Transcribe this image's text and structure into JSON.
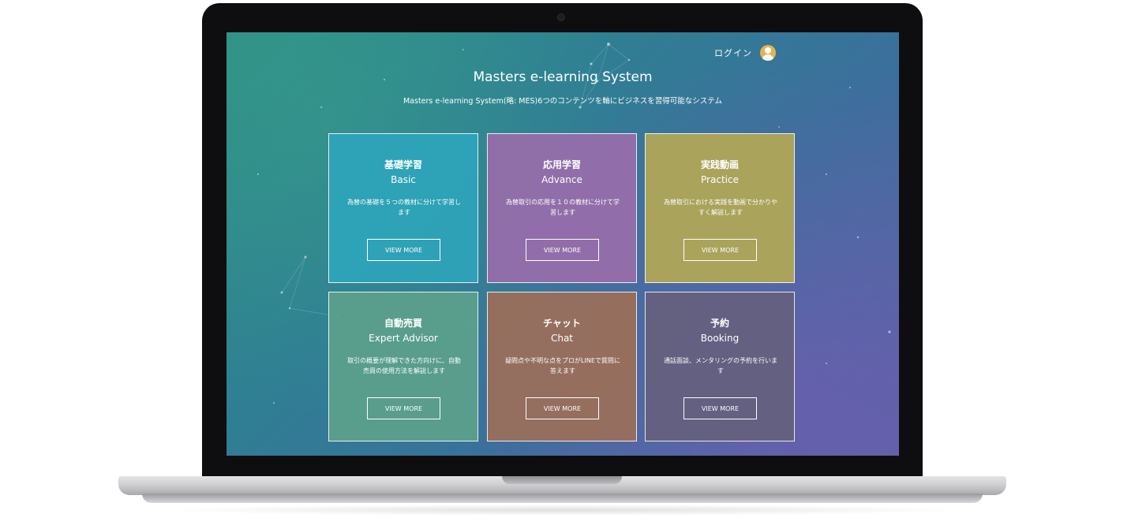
{
  "header": {
    "login_label": "ログイン",
    "title": "Masters e-learning System",
    "subtitle": "Masters e-learning System(略: MES)6つのコンテンツを軸にビジネスを習得可能なシステム"
  },
  "cards": [
    {
      "title": "基礎学習",
      "subtitle": "Basic",
      "description": "為替の基礎を５つの教材に分けて学習します",
      "button": "VIEW MORE",
      "color": "#2ea4ba"
    },
    {
      "title": "応用学習",
      "subtitle": "Advance",
      "description": "為替取引の応用を１０の教材に分けて学習します",
      "button": "VIEW MORE",
      "color": "#966eaa"
    },
    {
      "title": "実践動画",
      "subtitle": "Practice",
      "description": "為替取引における実践を動画で分かりやすく解説します",
      "button": "VIEW MORE",
      "color": "#aea658"
    },
    {
      "title": "自動売買",
      "subtitle": "Expert Advisor",
      "description": "取引の概要が理解できた方向けに、自動売買の使用方法を解説します",
      "button": "VIEW MORE",
      "color": "#5ca08c"
    },
    {
      "title": "チャット",
      "subtitle": "Chat",
      "description": "疑問点や不明な点をプロがLINEで質問に答えます",
      "button": "VIEW MORE",
      "color": "#986e5c"
    },
    {
      "title": "予約",
      "subtitle": "Booking",
      "description": "通話面談、メンタリングの予約を行います",
      "button": "VIEW MORE",
      "color": "#64607e"
    }
  ],
  "icons": {
    "user": "user-avatar-icon",
    "camera": "webcam-icon"
  }
}
